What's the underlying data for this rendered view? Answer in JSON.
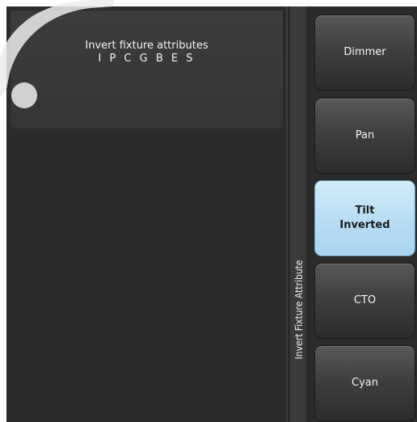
{
  "info": {
    "title": "Invert fixture attributes",
    "letters": "I P C G B E S"
  },
  "side_label": "Invert Fixture Attribute",
  "buttons": [
    {
      "label": "Dimmer",
      "active": false
    },
    {
      "label": "Pan",
      "active": false
    },
    {
      "label": "Tilt\nInverted",
      "active": true
    },
    {
      "label": "CTO",
      "active": false
    },
    {
      "label": "Cyan",
      "active": false
    }
  ],
  "colors": {
    "panel": "#2b2b2b",
    "button": "#3f3f3f",
    "active_button": "#b7dcf3",
    "text": "#f4f4f4"
  }
}
